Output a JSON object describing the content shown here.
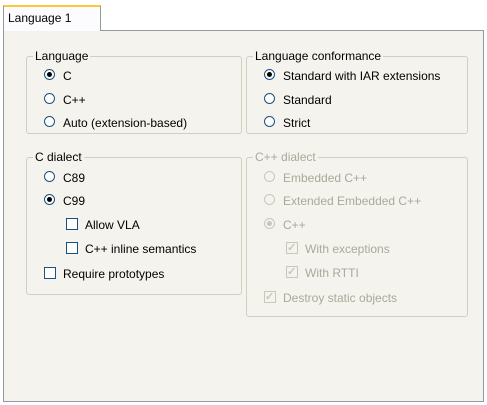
{
  "tab": {
    "label": "Language 1"
  },
  "language_group": {
    "title": "Language",
    "options": [
      {
        "label": "C",
        "checked": true
      },
      {
        "label": "C++",
        "checked": false
      },
      {
        "label": "Auto (extension-based)",
        "checked": false
      }
    ]
  },
  "conformance_group": {
    "title": "Language conformance",
    "options": [
      {
        "label": "Standard with IAR extensions",
        "checked": true
      },
      {
        "label": "Standard",
        "checked": false
      },
      {
        "label": "Strict",
        "checked": false
      }
    ]
  },
  "c_dialect_group": {
    "title": "C dialect",
    "c89_label": "C89",
    "c99_label": "C99",
    "allow_vla_label": "Allow VLA",
    "cpp_inline_label": "C++ inline semantics",
    "require_prototypes_label": "Require prototypes",
    "selected": "C99",
    "allow_vla": false,
    "cpp_inline": false,
    "require_prototypes": false
  },
  "cpp_dialect_group": {
    "title": "C++ dialect",
    "enabled": false,
    "embedded_label": "Embedded C++",
    "extended_label": "Extended Embedded C++",
    "cpp_label": "C++",
    "exceptions_label": "With exceptions",
    "rtti_label": "With RTTI",
    "destroy_label": "Destroy static objects",
    "selected": "C++",
    "with_exceptions": true,
    "with_rtti": true,
    "destroy_static": true
  },
  "colors": {
    "panel_bg": "#f4f3ee",
    "tab_accent": "#ffc83c",
    "radio_dot": "#21a121",
    "disabled_text": "#aca899"
  }
}
